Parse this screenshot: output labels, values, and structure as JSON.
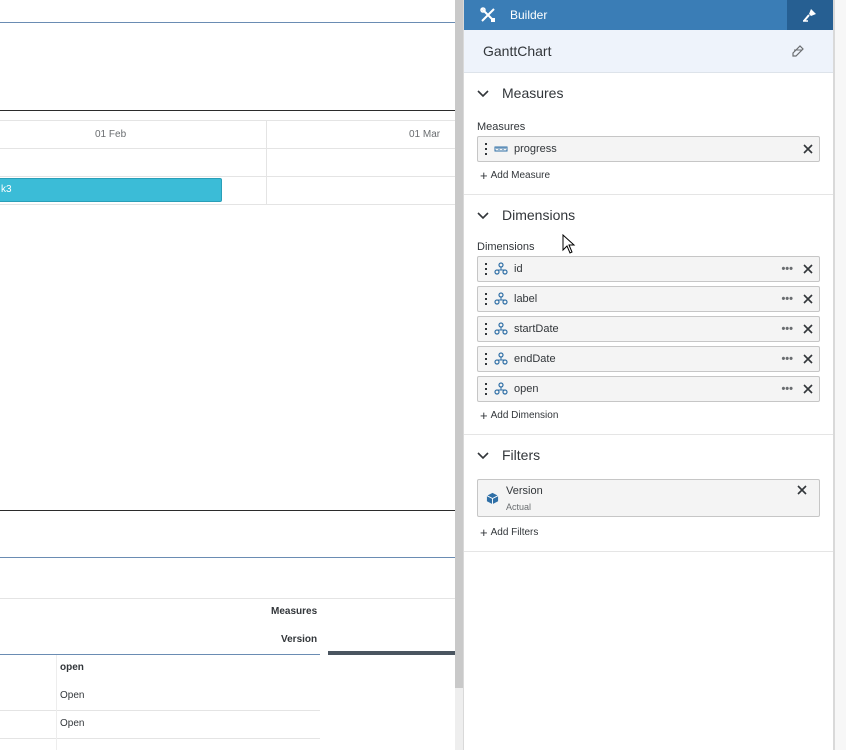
{
  "canvas": {
    "timeline_ticks": [
      "01 Feb",
      "01 Mar"
    ],
    "bar_label": "k3",
    "table": {
      "header_measures": "Measures",
      "header_version": "Version",
      "column_header": "open",
      "rows": [
        "Open",
        "Open"
      ]
    }
  },
  "builder": {
    "tab_builder_label": "Builder",
    "widget_title": "GanttChart",
    "measures": {
      "title": "Measures",
      "label": "Measures",
      "items": [
        "progress"
      ],
      "add_label": "Add Measure"
    },
    "dimensions": {
      "title": "Dimensions",
      "label": "Dimensions",
      "items": [
        "id",
        "label",
        "startDate",
        "endDate",
        "open"
      ],
      "more_glyph": "•••",
      "add_label": "Add Dimension"
    },
    "filters": {
      "title": "Filters",
      "items": [
        {
          "name": "Version",
          "value": "Actual"
        }
      ],
      "add_label": "Add Filters"
    }
  },
  "colors": {
    "tab_bar": "#3a7db6",
    "tab_active": "#265f92",
    "gantt_bar": "#3bbcd7",
    "dimension_icon": "#2f6fa6"
  },
  "icons": {
    "builder_tab": "tools-icon",
    "styling_tab": "paint-brush-icon",
    "widget_edit": "edit-icon",
    "section_toggle": "chevron-down-icon",
    "measure": "ruler-icon",
    "dimension": "dimension-icon",
    "filter": "cube-icon",
    "remove": "close-icon"
  }
}
